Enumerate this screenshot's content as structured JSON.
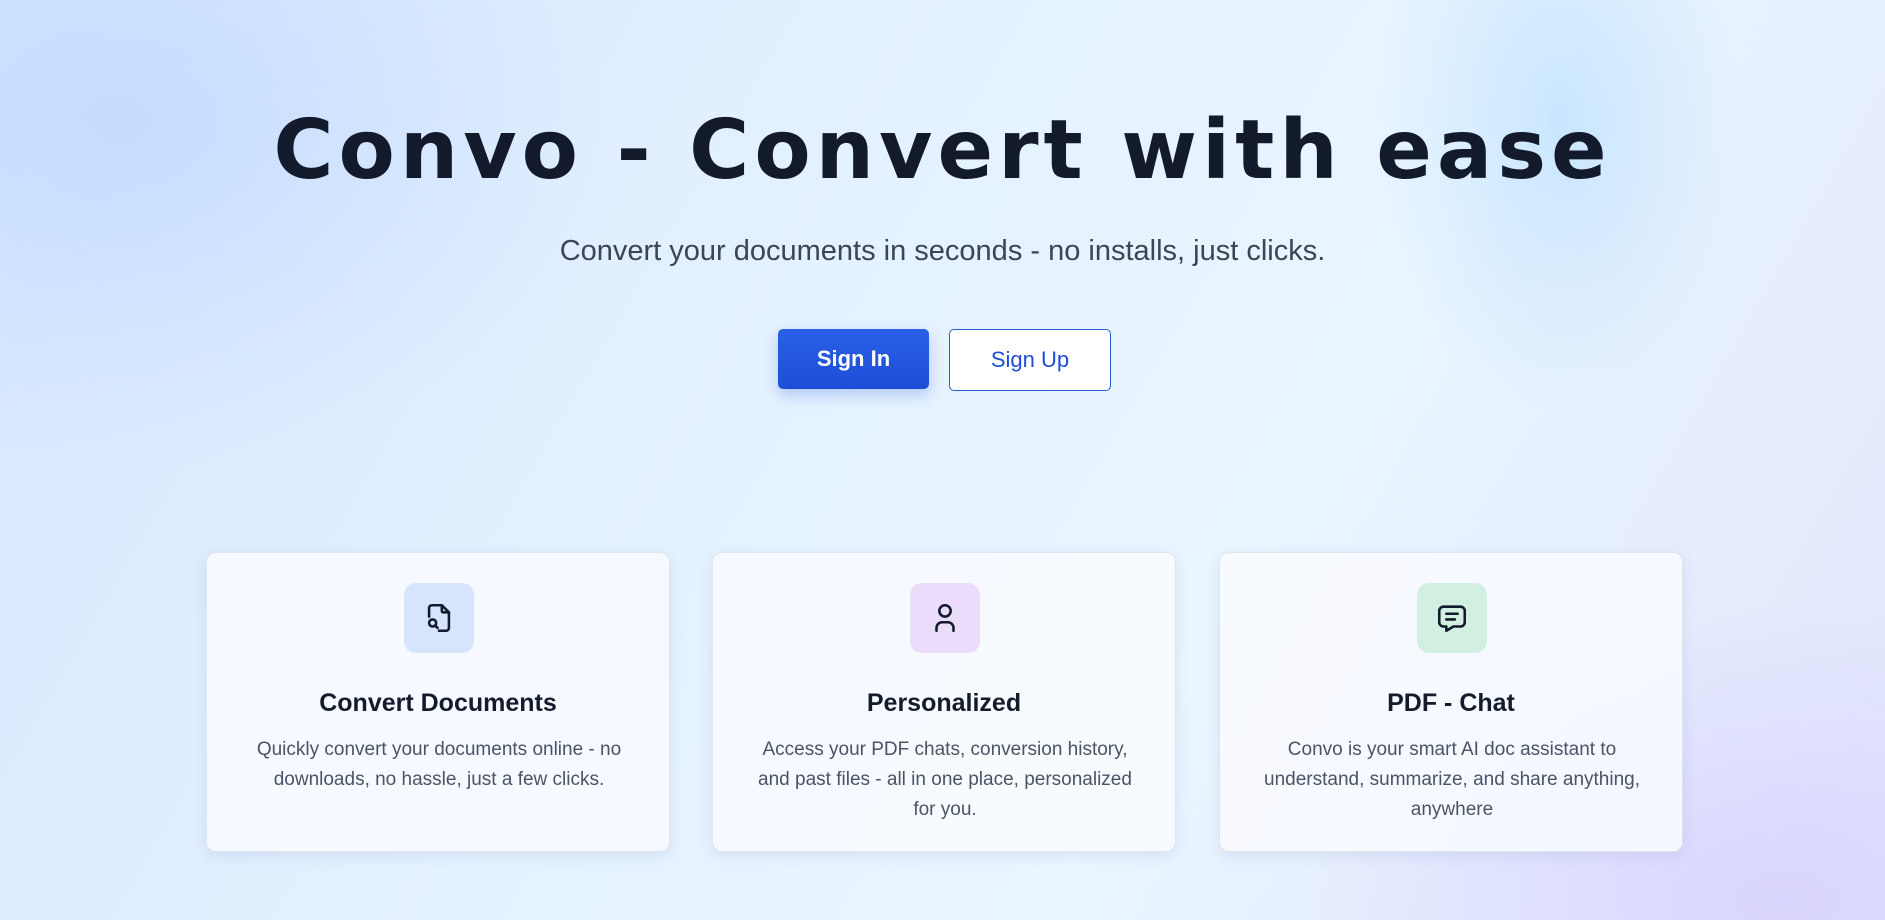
{
  "hero": {
    "title": "Convo - Convert with ease",
    "subtitle": "Convert your documents in seconds - no installs, just clicks."
  },
  "actions": {
    "sign_in_label": "Sign In",
    "sign_up_label": "Sign Up"
  },
  "features": [
    {
      "icon": "file-search-icon",
      "title": "Convert Documents",
      "description": "Quickly convert your documents online - no downloads, no hassle, just a few clicks."
    },
    {
      "icon": "user-icon",
      "title": "Personalized",
      "description": "Access your PDF chats, conversion history, and past files - all in one place, personalized for you."
    },
    {
      "icon": "chat-message-icon",
      "title": "PDF - Chat",
      "description": "Convo is your smart AI doc assistant to understand, summarize, and share anything, anywhere"
    }
  ],
  "colors": {
    "primary": "#1d4ed8",
    "heading": "#121a2b",
    "icon_bg_blue": "#d6e5fc",
    "icon_bg_purple": "#ecdcfb",
    "icon_bg_green": "#d2f0e1"
  }
}
